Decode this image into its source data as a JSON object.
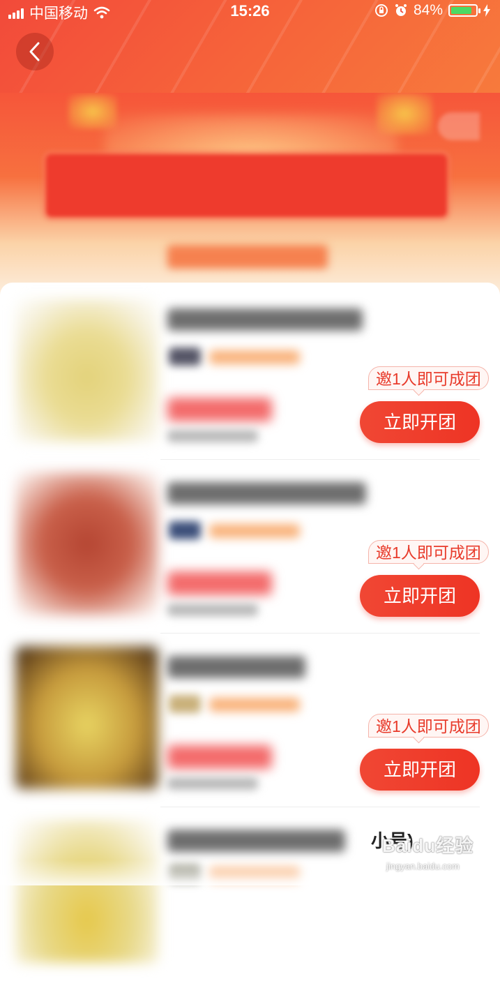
{
  "status_bar": {
    "carrier": "中国移动",
    "time": "15:26",
    "battery_percent": "84%",
    "battery_level": 0.84,
    "icons": [
      "signal-icon",
      "wifi-icon",
      "orientation-lock-icon",
      "alarm-icon",
      "battery-icon",
      "charging-icon"
    ]
  },
  "header": {
    "back_icon": "chevron-left-icon"
  },
  "products": [
    {
      "tag": "邀1人即可成团",
      "button": "立即开团",
      "thumb_color": "#e9d98a",
      "name_suffix": ""
    },
    {
      "tag": "邀1人即可成团",
      "button": "立即开团",
      "thumb_color": "#c6503c",
      "name_suffix": ""
    },
    {
      "tag": "邀1人即可成团",
      "button": "立即开团",
      "thumb_color": "#c9a545",
      "name_suffix": ""
    },
    {
      "tag": "",
      "button": "",
      "thumb_color": "#e6c84a",
      "name_suffix": "小号)"
    }
  ],
  "watermark": {
    "logo": "Baidu经验",
    "url": "jingyan.baidu.com"
  },
  "colors": {
    "accent": "#ee3424",
    "header": "#f24a3a"
  }
}
